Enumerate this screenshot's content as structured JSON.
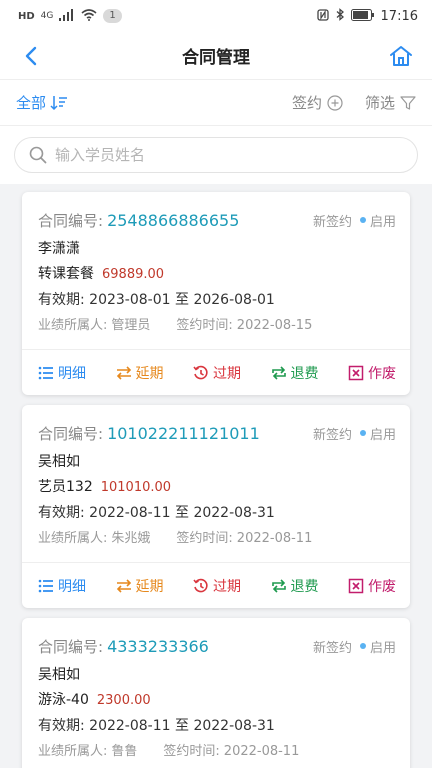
{
  "status_bar": {
    "carrier": "HD",
    "network": "4G",
    "badge": "1",
    "time": "17:16"
  },
  "header": {
    "title": "合同管理"
  },
  "filter": {
    "all_label": "全部",
    "sign_label": "签约",
    "filter_label": "筛选"
  },
  "search": {
    "placeholder": "输入学员姓名",
    "value": ""
  },
  "labels": {
    "contract_no": "合同编号:",
    "valid": "有效期:",
    "to": "至",
    "owner": "业绩所属人:",
    "sign_time": "签约时间:"
  },
  "actions": {
    "detail": "明细",
    "extend": "延期",
    "expire": "过期",
    "refund": "退费",
    "void": "作废"
  },
  "contracts": [
    {
      "no": "2548866886655",
      "type": "新签约",
      "status": "启用",
      "student": "李潇潇",
      "package": "转课套餐",
      "price": "69889.00",
      "start": "2023-08-01",
      "end": "2026-08-01",
      "owner": "管理员",
      "sign_time": "2022-08-15"
    },
    {
      "no": "101022211121011",
      "type": "新签约",
      "status": "启用",
      "student": "吴相如",
      "package": "艺员132",
      "price": "101010.00",
      "start": "2022-08-11",
      "end": "2022-08-31",
      "owner": "朱兆娥",
      "sign_time": "2022-08-11"
    },
    {
      "no": "4333233366",
      "type": "新签约",
      "status": "启用",
      "student": "吴相如",
      "package": "游泳-40",
      "price": "2300.00",
      "start": "2022-08-11",
      "end": "2022-08-31",
      "owner": "鲁鲁",
      "sign_time": "2022-08-11"
    }
  ],
  "colors": {
    "accent": "#2d8cf0",
    "contract_no": "#1e9bb8",
    "price": "#c0392b"
  }
}
